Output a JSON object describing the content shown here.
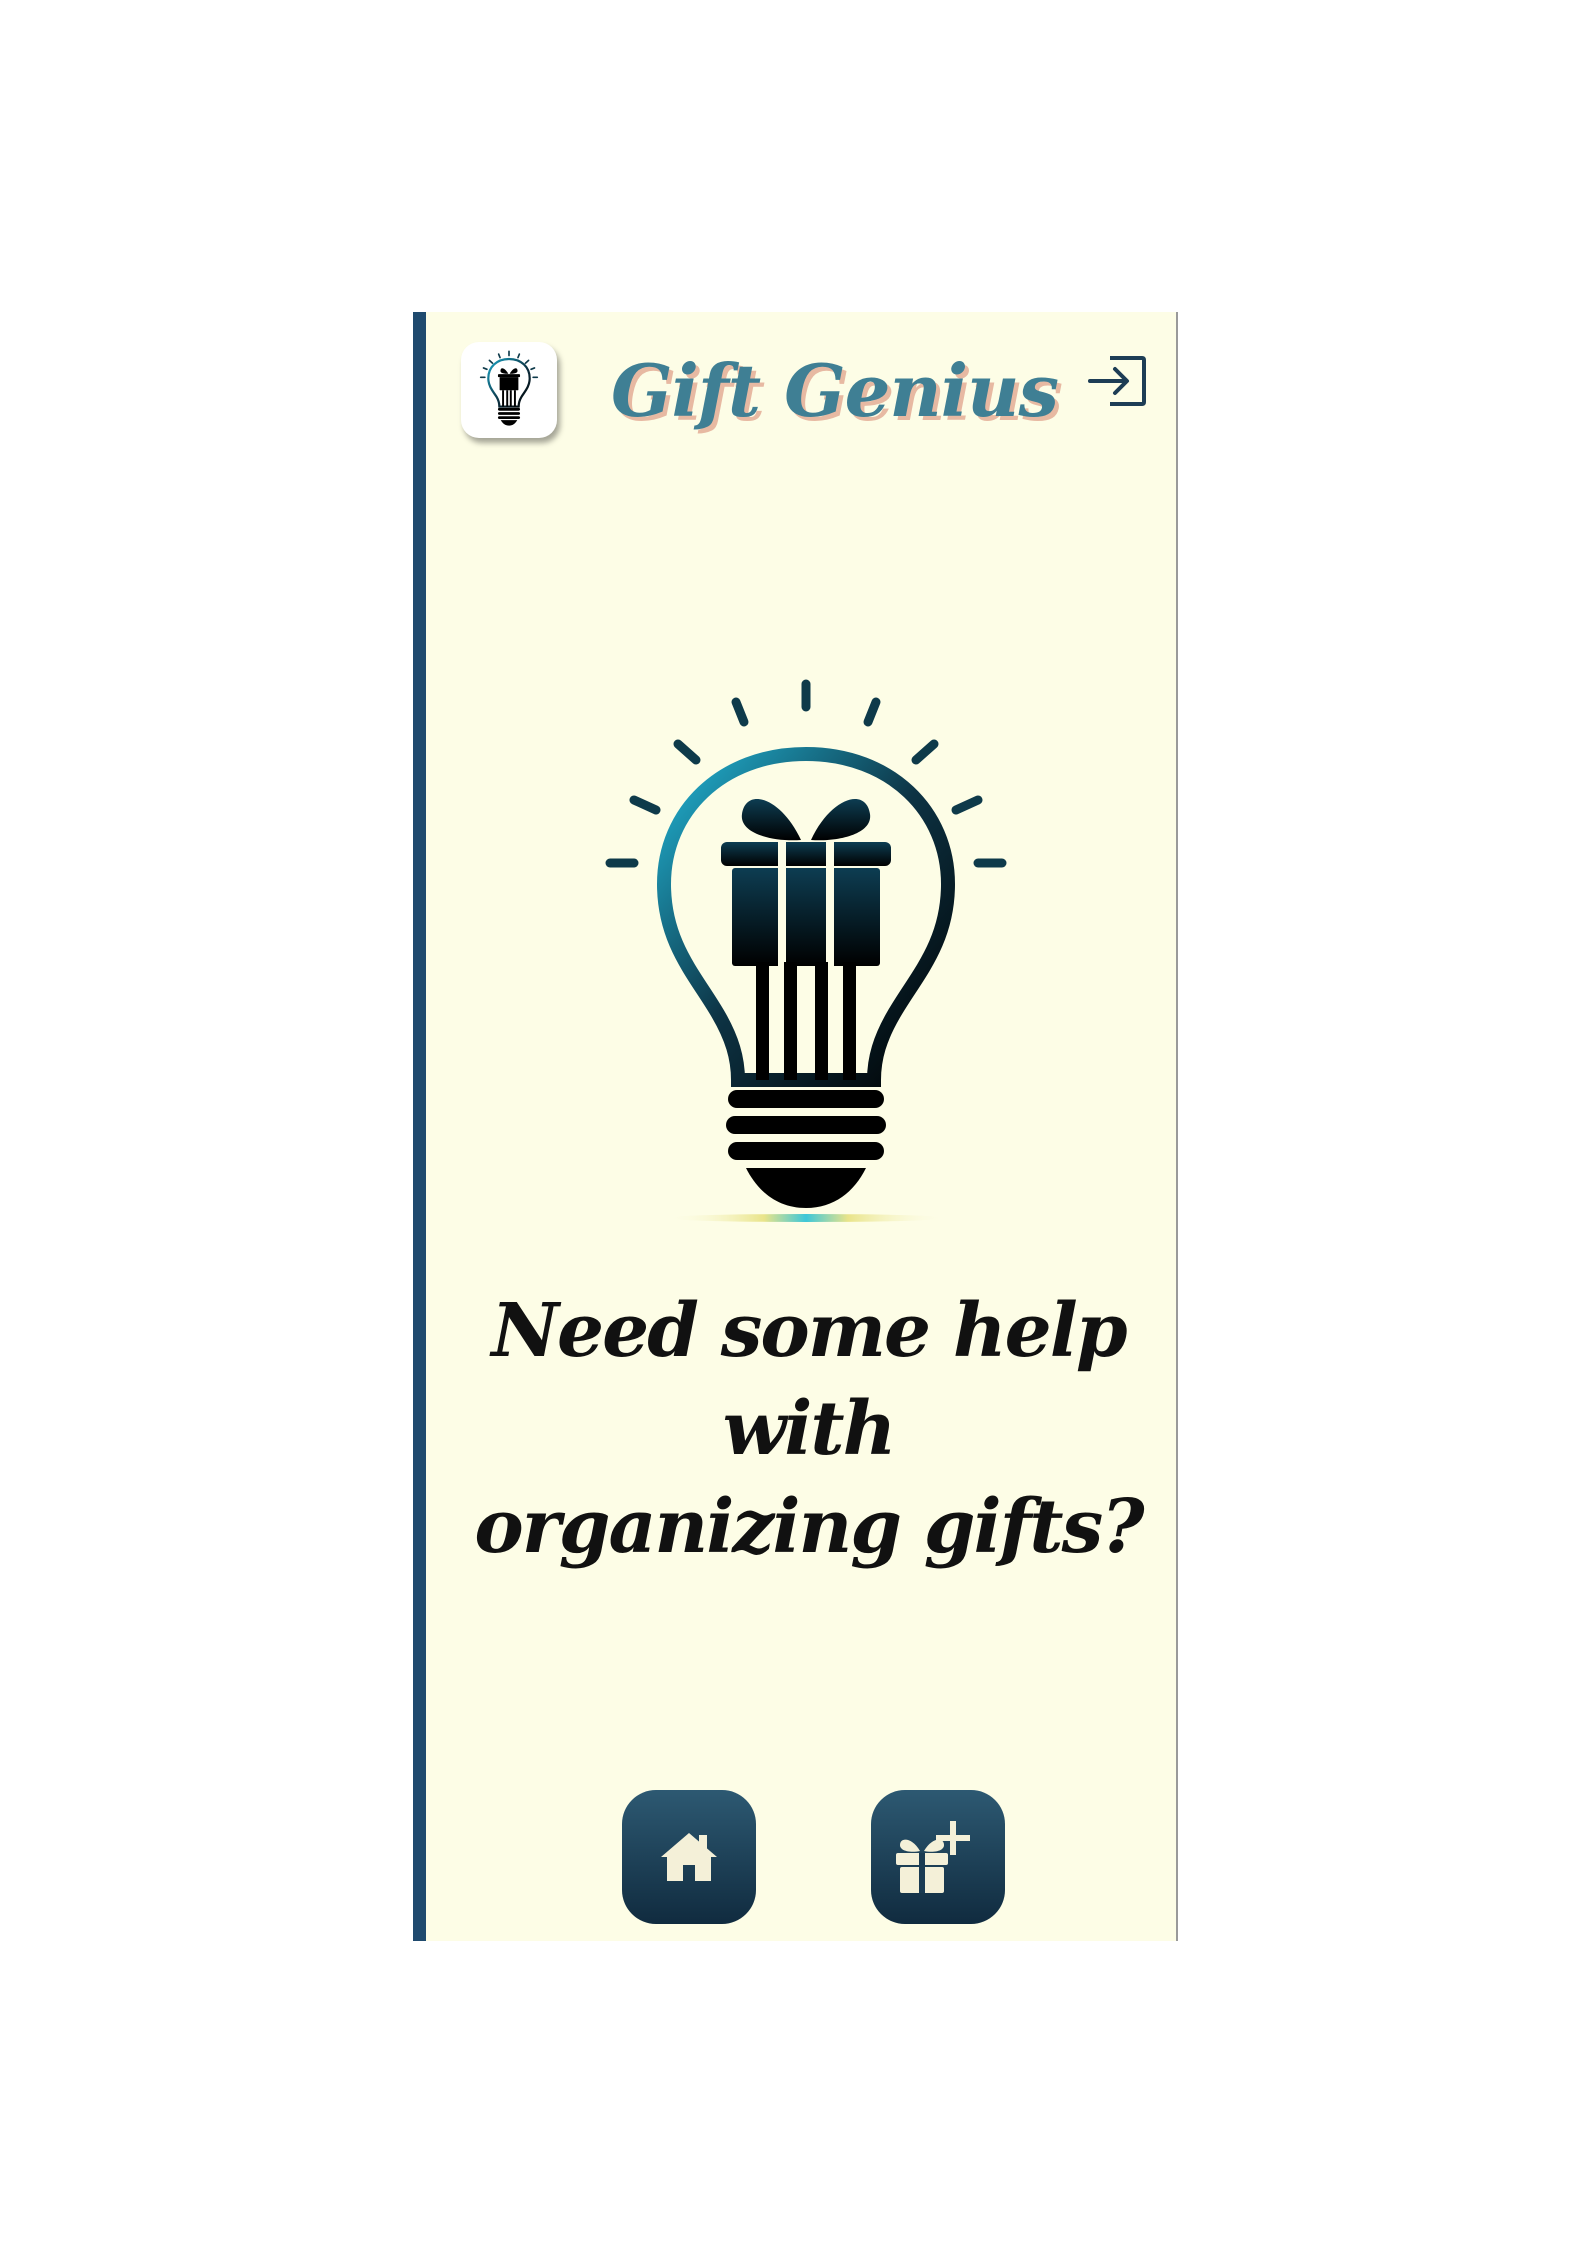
{
  "header": {
    "app_title": "Gift Genius",
    "logo_icon": "lightbulb-gift-icon",
    "login_icon": "login-icon"
  },
  "hero": {
    "illustration_icon": "lightbulb-gift-icon"
  },
  "main": {
    "tagline_line1": "Need some help with",
    "tagline_line2": "organizing gifts?"
  },
  "bottom_nav": {
    "items": [
      {
        "icon": "home-icon"
      },
      {
        "icon": "add-gift-icon"
      }
    ]
  },
  "colors": {
    "background": "#fdfde6",
    "accent_border": "#1f4a6e",
    "title_color": "#3f7f94",
    "title_shadow": "#e7b9a2",
    "nav_button_top": "#2d5972",
    "nav_button_bottom": "#102b3f",
    "icon_teal": "#1aa5c6"
  }
}
